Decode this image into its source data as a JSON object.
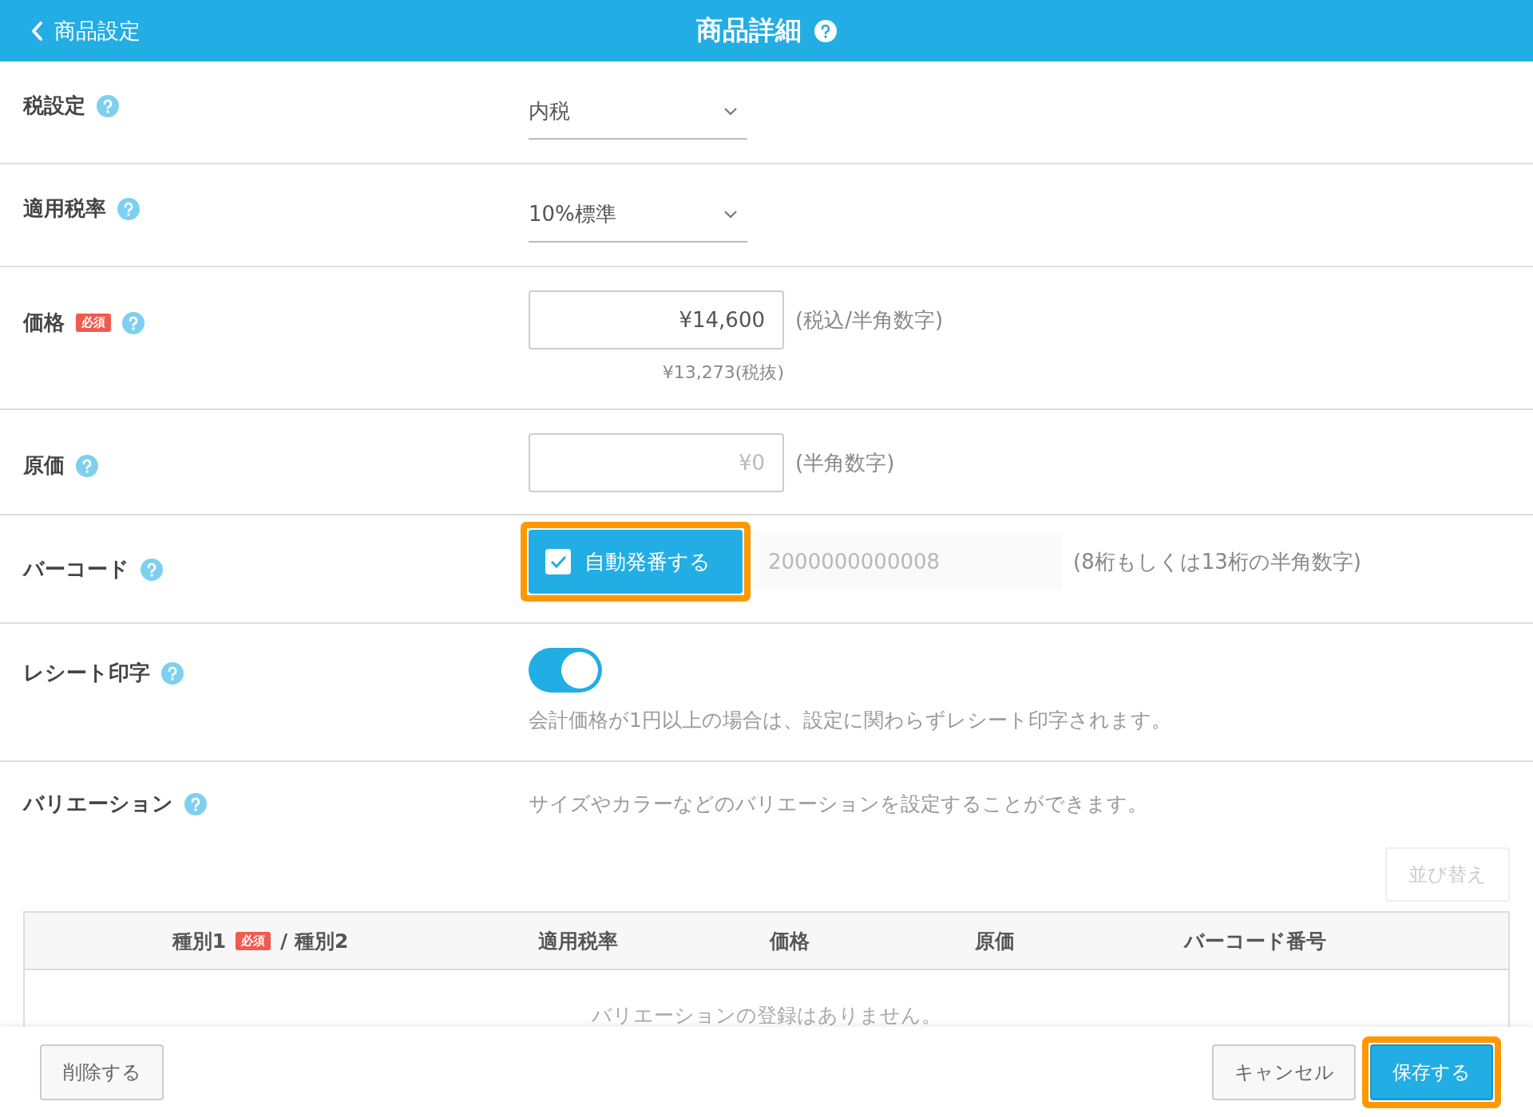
{
  "header": {
    "back_label": "商品設定",
    "title": "商品詳細"
  },
  "fields": [
    {
      "kind": "select",
      "label": "税設定",
      "value": "内税"
    },
    {
      "kind": "select",
      "label": "適用税率",
      "value": "10%標準"
    },
    {
      "kind": "price",
      "label": "価格",
      "badge": "必須",
      "value": "¥14,600",
      "hint": "(税込/半角数字)",
      "sub_text": "¥13,273(税抜)"
    },
    {
      "kind": "input",
      "label": "原価",
      "placeholder": "¥0",
      "hint": "(半角数字)"
    },
    {
      "kind": "barcode",
      "label": "バーコード",
      "checkbox_label": "自動発番する",
      "checked": true,
      "highlighted": true,
      "placeholder": "2000000000008",
      "disabled": true,
      "hint": "(8桁もしくは13桁の半角数字)"
    },
    {
      "kind": "toggle",
      "label": "レシート印字",
      "on": true,
      "note": "会計価格が1円以上の場合は、設定に関わらずレシート印字されます。"
    },
    {
      "kind": "variations",
      "label": "バリエーション",
      "note": "サイズやカラーなどのバリエーションを設定することができます。",
      "sort_button": "並び替え"
    }
  ],
  "variation_table": {
    "columns": [
      {
        "label": "種別1",
        "badge": "必須",
        "suffix": "/ 種別2"
      },
      {
        "label": "適用税率"
      },
      {
        "label": "価格"
      },
      {
        "label": "原価"
      },
      {
        "label": "バーコード番号"
      }
    ],
    "empty_text": "バリエーションの登録はありません。"
  },
  "footer": {
    "delete_button": "削除する",
    "cancel_button": "キャンセル",
    "save_button": {
      "label": "保存する",
      "highlighted": true
    }
  }
}
